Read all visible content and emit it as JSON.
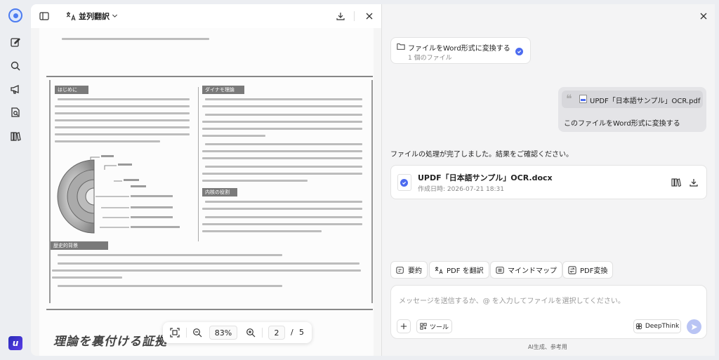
{
  "doc_toolbar": {
    "mode_label": "並列翻訳"
  },
  "zoom": {
    "value": "83%",
    "page_current": "2",
    "page_sep": "/",
    "page_total": "5"
  },
  "document": {
    "title_text": "理論を裏付ける証拠"
  },
  "chat": {
    "task_card": {
      "title": "ファイルをWord形式に変換する",
      "subtitle": "1 個のファイル"
    },
    "user_message": {
      "file_name": "UPDF「日本語サンプル」OCR.pdf",
      "text": "このファイルをWord形式に変換する"
    },
    "ai_reply": "ファイルの処理が完了しました。結果をご確認ください。",
    "result_file": {
      "name": "UPDF「日本語サンプル」OCR.docx",
      "created": "作成日時: 2026-07-21 18:31"
    },
    "quick_actions": [
      "要約",
      "PDF を翻訳",
      "マインドマップ",
      "PDF変換"
    ],
    "input": {
      "placeholder": "メッセージを送信するか、@ を入力してファイルを選択してください。",
      "tools_label": "ツール",
      "deepthink_label": "DeepThink"
    },
    "footer_note": "AI生成、参考用"
  },
  "colors": {
    "accent": "#4d6cf0",
    "brand": "#3a2fd0"
  }
}
